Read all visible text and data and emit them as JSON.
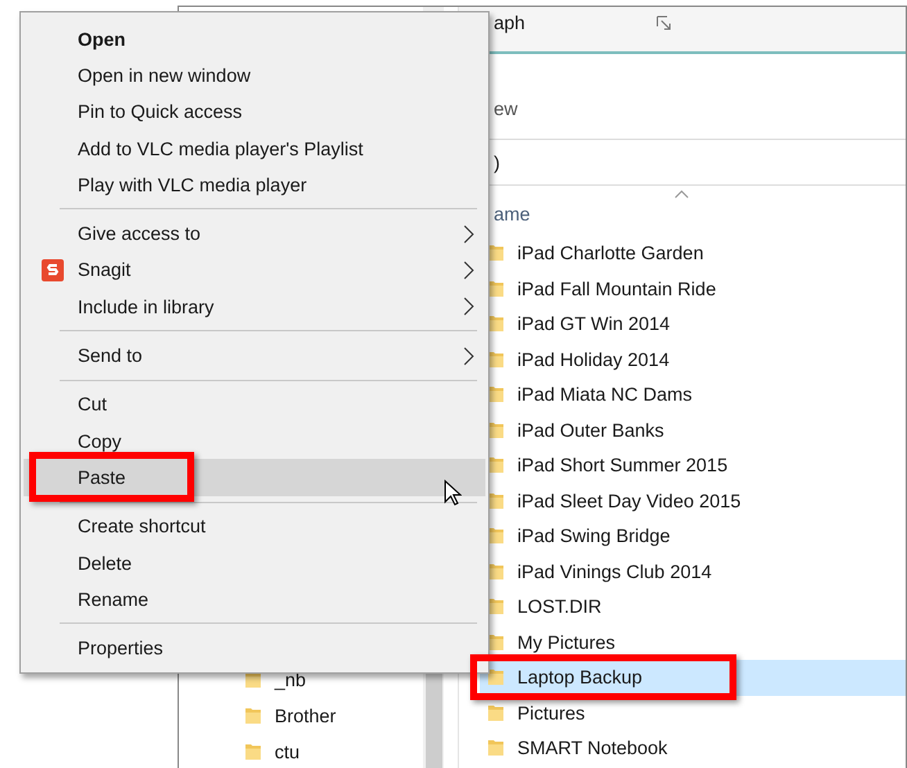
{
  "explorer": {
    "ribbon_tab": "aph",
    "ribbon_label": "ew",
    "address_fragment": ")",
    "column_header": "ame",
    "nav_items": [
      {
        "name": "_nb"
      },
      {
        "name": "Brother"
      },
      {
        "name": "ctu"
      }
    ],
    "files": [
      {
        "name": "iPad Charlotte Garden",
        "selected": false,
        "annotated": false
      },
      {
        "name": "iPad Fall Mountain Ride",
        "selected": false,
        "annotated": false
      },
      {
        "name": "iPad GT Win 2014",
        "selected": false,
        "annotated": false
      },
      {
        "name": "iPad Holiday 2014",
        "selected": false,
        "annotated": false
      },
      {
        "name": "iPad Miata NC Dams",
        "selected": false,
        "annotated": false
      },
      {
        "name": "iPad Outer Banks",
        "selected": false,
        "annotated": false
      },
      {
        "name": "iPad Short Summer 2015",
        "selected": false,
        "annotated": false
      },
      {
        "name": "iPad Sleet Day Video 2015",
        "selected": false,
        "annotated": false
      },
      {
        "name": "iPad Swing Bridge",
        "selected": false,
        "annotated": false
      },
      {
        "name": "iPad Vinings Club 2014",
        "selected": false,
        "annotated": false
      },
      {
        "name": "LOST.DIR",
        "selected": false,
        "annotated": false
      },
      {
        "name": "My Pictures",
        "selected": false,
        "annotated": false
      },
      {
        "name": "Laptop Backup",
        "selected": true,
        "annotated": true
      },
      {
        "name": "Pictures",
        "selected": false,
        "annotated": false
      },
      {
        "name": "SMART Notebook",
        "selected": false,
        "annotated": false
      }
    ]
  },
  "context_menu": {
    "groups": [
      [
        {
          "label": "Open",
          "bold": true,
          "submenu": false,
          "selected": false,
          "annotated": false
        },
        {
          "label": "Open in new window",
          "bold": false,
          "submenu": false,
          "selected": false,
          "annotated": false
        },
        {
          "label": "Pin to Quick access",
          "bold": false,
          "submenu": false,
          "selected": false,
          "annotated": false
        },
        {
          "label": "Add to VLC media player's Playlist",
          "bold": false,
          "submenu": false,
          "selected": false,
          "annotated": false
        },
        {
          "label": "Play with VLC media player",
          "bold": false,
          "submenu": false,
          "selected": false,
          "annotated": false
        }
      ],
      [
        {
          "label": "Give access to",
          "bold": false,
          "submenu": true,
          "selected": false,
          "annotated": false
        },
        {
          "label": "Snagit",
          "bold": false,
          "submenu": true,
          "selected": false,
          "annotated": false,
          "kind": "with_icon"
        },
        {
          "label": "Include in library",
          "bold": false,
          "submenu": true,
          "selected": false,
          "annotated": false
        }
      ],
      [
        {
          "label": "Send to",
          "bold": false,
          "submenu": true,
          "selected": false,
          "annotated": false
        }
      ],
      [
        {
          "label": "Cut",
          "bold": false,
          "submenu": false,
          "selected": false,
          "annotated": false
        },
        {
          "label": "Copy",
          "bold": false,
          "submenu": false,
          "selected": false,
          "annotated": false
        },
        {
          "label": "Paste",
          "bold": false,
          "submenu": false,
          "selected": true,
          "annotated": true
        }
      ],
      [
        {
          "label": "Create shortcut",
          "bold": false,
          "submenu": false,
          "selected": false,
          "annotated": false
        },
        {
          "label": "Delete",
          "bold": false,
          "submenu": false,
          "selected": false,
          "annotated": false
        },
        {
          "label": "Rename",
          "bold": false,
          "submenu": false,
          "selected": false,
          "annotated": false
        }
      ],
      [
        {
          "label": "Properties",
          "bold": false,
          "submenu": false,
          "selected": false,
          "annotated": false
        }
      ]
    ]
  }
}
